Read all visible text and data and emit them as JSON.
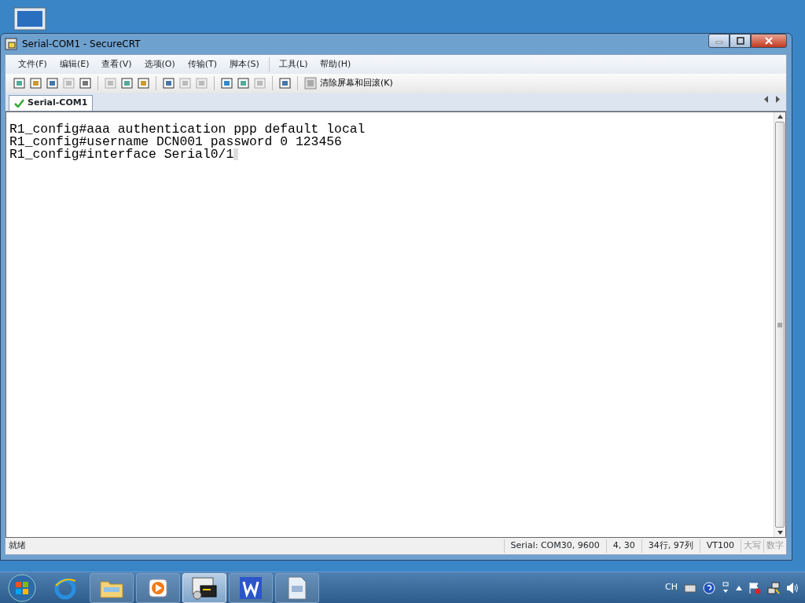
{
  "window": {
    "title": "Serial-COM1 - SecureCRT"
  },
  "menu": [
    "文件(F)",
    "编辑(E)",
    "查看(V)",
    "选项(O)",
    "传输(T)",
    "脚本(S)",
    "工具(L)",
    "帮助(H)"
  ],
  "toolbar": [
    {
      "kind": "icon",
      "disabled": false
    },
    {
      "kind": "icon",
      "disabled": false
    },
    {
      "kind": "icon",
      "disabled": false
    },
    {
      "kind": "icon",
      "disabled": true
    },
    {
      "kind": "icon",
      "disabled": false
    },
    {
      "kind": "separator"
    },
    {
      "kind": "icon",
      "disabled": true
    },
    {
      "kind": "icon",
      "disabled": false
    },
    {
      "kind": "icon",
      "disabled": false
    },
    {
      "kind": "separator"
    },
    {
      "kind": "icon",
      "disabled": false
    },
    {
      "kind": "icon",
      "disabled": true
    },
    {
      "kind": "icon",
      "disabled": true
    },
    {
      "kind": "separator"
    },
    {
      "kind": "icon",
      "disabled": false
    },
    {
      "kind": "icon",
      "disabled": false
    },
    {
      "kind": "icon",
      "disabled": true
    },
    {
      "kind": "separator"
    },
    {
      "kind": "icon",
      "disabled": false
    },
    {
      "kind": "separator"
    },
    {
      "kind": "button",
      "label": "清除屏幕和回滚(K)"
    }
  ],
  "tabs": [
    {
      "label": "Serial-COM1",
      "selected": true
    }
  ],
  "terminal": {
    "lines": [
      "R1_config#aaa authentication ppp default local",
      "R1_config#username DCN001 password 0 123456",
      "R1_config#interface Serial0/1"
    ]
  },
  "status_bar": {
    "message": "就绪",
    "fields": [
      {
        "text": "Serial: COM30, 9600",
        "disabled": false
      },
      {
        "text": "4,  30",
        "disabled": false
      },
      {
        "text": "34行, 97列",
        "disabled": false
      },
      {
        "text": "VT100",
        "disabled": false
      },
      {
        "text": "大写",
        "disabled": true
      },
      {
        "text": "数字",
        "disabled": true
      }
    ]
  },
  "taskbar": {
    "items": [
      {
        "kind": "ie",
        "selected": false
      },
      {
        "kind": "folder",
        "selected": false
      },
      {
        "kind": "media",
        "selected": false
      },
      {
        "kind": "terminal",
        "selected": true
      },
      {
        "kind": "writer",
        "selected": false
      },
      {
        "kind": "document",
        "selected": false
      }
    ],
    "tray": {
      "language": "CH"
    }
  }
}
